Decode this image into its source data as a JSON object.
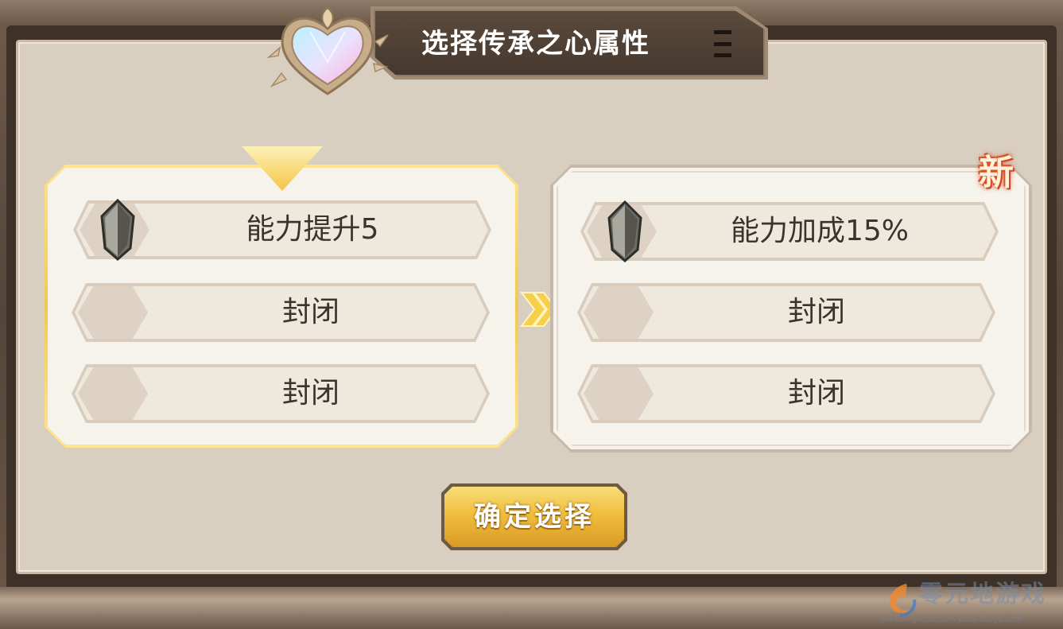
{
  "header": {
    "title": "选择传承之心属性",
    "menu_icon": "hamburger-menu-icon",
    "emblem_icon": "crystal-heart-icon"
  },
  "current": {
    "rows": [
      {
        "label": "能力提升5",
        "icon": "gray-crystal-icon",
        "locked": false
      },
      {
        "label": "封闭",
        "locked": true
      },
      {
        "label": "封闭",
        "locked": true
      }
    ]
  },
  "new_option": {
    "badge": "新",
    "rows": [
      {
        "label": "能力加成15%",
        "icon": "gray-crystal-icon",
        "locked": false
      },
      {
        "label": "封闭",
        "locked": true
      },
      {
        "label": "封闭",
        "locked": true
      }
    ]
  },
  "confirm_button": {
    "label": "确定选择"
  },
  "watermark": {
    "text": "零元地游戏",
    "url": "www.lingliuyx.com  www.06zyx.com"
  },
  "colors": {
    "selected_border": "#f4c850",
    "panel_bg": "#d9cfc0",
    "button_gold": "#f0bf3e"
  }
}
